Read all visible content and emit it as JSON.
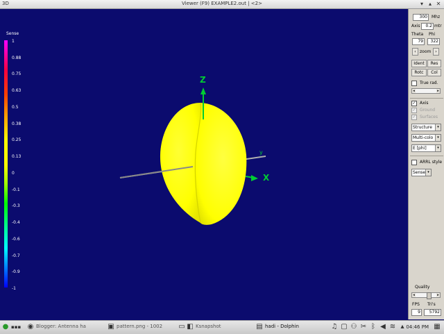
{
  "window": {
    "app_badge": "3D",
    "title": "Viewer (F9)   EXAMPLE2.out | <2>",
    "minimize": "▾",
    "maximize": "▴",
    "close": "✕"
  },
  "legend": {
    "title": "Sense",
    "ticks": [
      "1",
      "0.88",
      "0.75",
      "0.63",
      "0.5",
      "0.38",
      "0.25",
      "0.13",
      "0",
      "-0.1",
      "-0.3",
      "-0.4",
      "-0.6",
      "-0.7",
      "-0.9",
      "-1"
    ]
  },
  "axes": {
    "z": "Z",
    "x": "X",
    "y": "y"
  },
  "colors": {
    "background": "#0b0b6e",
    "pattern": "#ffff00",
    "axis": "#00cc33"
  },
  "panel": {
    "freq_value": "300",
    "freq_unit": "Mhz",
    "axis_label": "Axis",
    "axis_value": "0.2",
    "axis_unit": "mtr",
    "theta_label": "Theta",
    "phi_label": "Phi",
    "theta_value": "79",
    "phi_value": "322",
    "zoom_left": "‹",
    "zoom_label": "zoom",
    "zoom_right": "›",
    "ident_label": "Ident",
    "res_label": "Res",
    "rotc_label": "Rotc",
    "col_label": "Col",
    "true_rad_label": "True rad.",
    "slider_left": "◂",
    "slider_right": "▸",
    "axis_check_label": "Axis",
    "ground_label": "Ground",
    "surfaces_label": "Surfaces",
    "structure_select": "Structure",
    "multicolor_select": "Multi-colo",
    "field_select": "E [phi]",
    "arrl_label": "ARRL style",
    "sense_select": "Sense",
    "quality_label": "Quality",
    "fps_label": "FPS",
    "tris_label": "Tri's",
    "fps_value": "9",
    "tris_value": "5792",
    "dropdown_arrow": "▾"
  },
  "taskbar": {
    "items": [
      {
        "icon": "web-icon",
        "label": "Blogger: Antenna ha"
      },
      {
        "icon": "image-icon",
        "label": "pattern.png - 1002"
      },
      {
        "icon": "window-icon",
        "label": ""
      },
      {
        "icon": "camera-icon",
        "label": "Ksnapshot"
      },
      {
        "icon": "folder-icon",
        "label": "hadi - Dolphin"
      }
    ],
    "clock": "04:46 PM"
  }
}
